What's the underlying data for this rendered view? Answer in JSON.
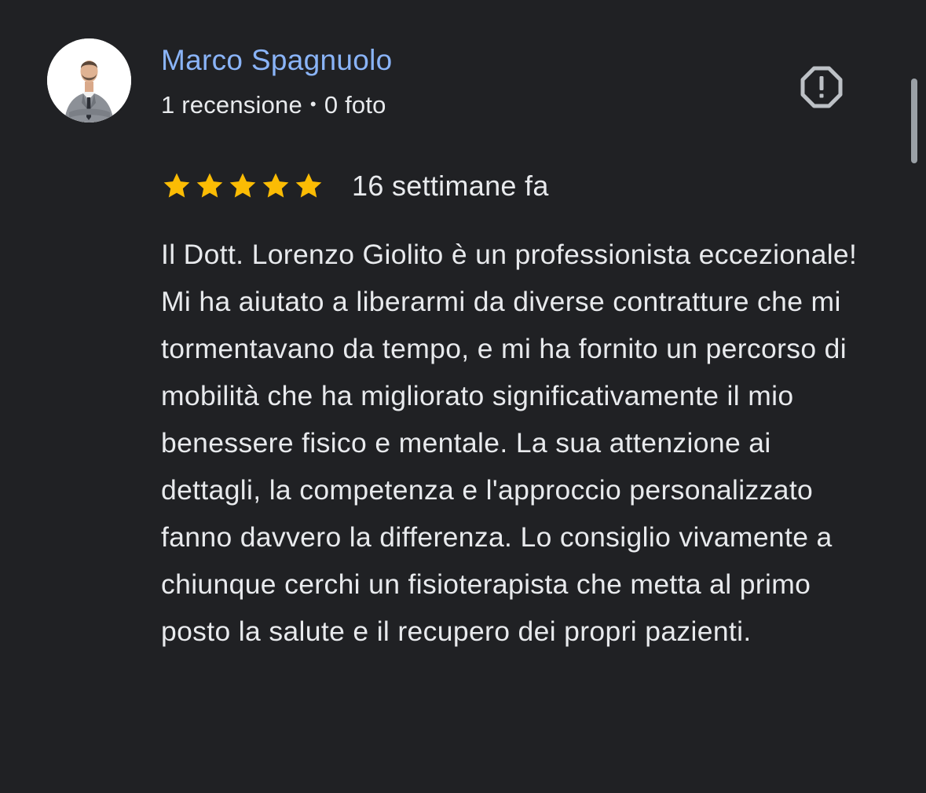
{
  "review": {
    "author": {
      "name": "Marco Spagnuolo",
      "reviews_count": "1 recensione",
      "separator": "•",
      "photos_count": "0 foto"
    },
    "rating": {
      "stars": 5,
      "max": 5,
      "star_color": "#fbbc04"
    },
    "date": "16 settimane fa",
    "text": "Il Dott. Lorenzo Giolito è un professionista eccezionale! Mi ha aiutato a liberarmi da diverse contratture che mi tormentavano da tempo, e mi ha fornito un percorso di mobilità che ha migliorato significativamente il mio benessere fisico e mentale. La sua attenzione ai dettagli, la competenza e l'approccio personalizzato fanno davvero la differenza. Lo consiglio vivamente a chiunque cerchi un fisioterapista che metta al primo posto la salute e il recupero dei propri pazienti.",
    "report_icon": "report-icon"
  },
  "colors": {
    "background": "#202124",
    "author_name": "#8ab4f8",
    "text": "#e8eaed",
    "icon": "#bdc1c6"
  }
}
